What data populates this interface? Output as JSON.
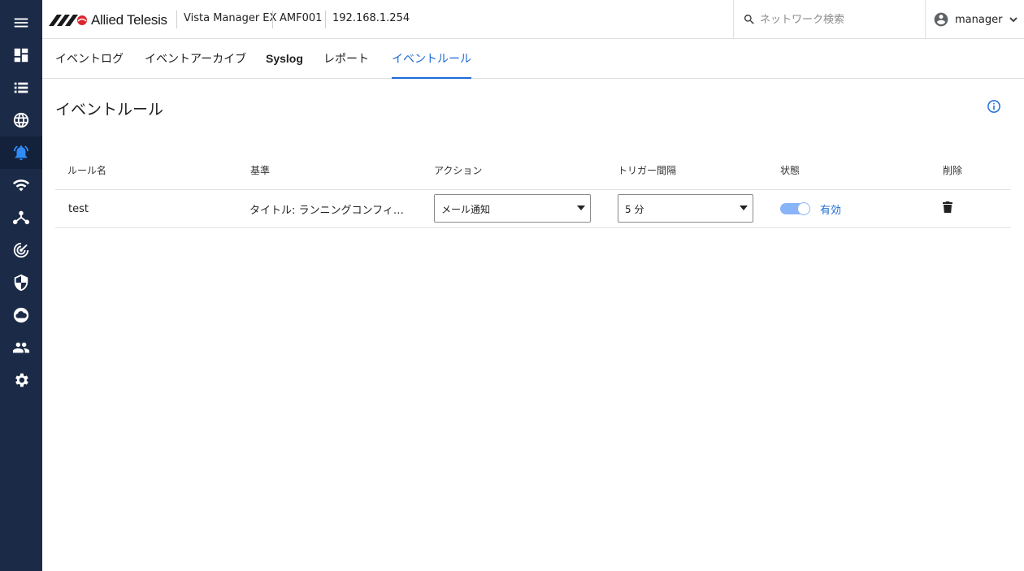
{
  "header": {
    "brand": "Allied Telesis",
    "product": "Vista Manager EX",
    "device": "AMF001",
    "ip": "192.168.1.254",
    "search_placeholder": "ネットワーク検索",
    "user": "manager"
  },
  "sidebar": {
    "items": [
      {
        "name": "menu",
        "icon": "menu-icon"
      },
      {
        "name": "dashboard",
        "icon": "dashboard-icon"
      },
      {
        "name": "list",
        "icon": "list-icon"
      },
      {
        "name": "network",
        "icon": "globe-icon"
      },
      {
        "name": "events",
        "icon": "bell-icon",
        "active": true
      },
      {
        "name": "wireless",
        "icon": "wifi-icon"
      },
      {
        "name": "topology",
        "icon": "topology-icon"
      },
      {
        "name": "monitor",
        "icon": "radar-icon"
      },
      {
        "name": "security",
        "icon": "shield-icon"
      },
      {
        "name": "cloud",
        "icon": "cloud-icon"
      },
      {
        "name": "users",
        "icon": "people-icon"
      },
      {
        "name": "settings",
        "icon": "gear-icon"
      }
    ]
  },
  "tabs": [
    {
      "label": "イベントログ"
    },
    {
      "label": "イベントアーカイブ"
    },
    {
      "label": "Syslog"
    },
    {
      "label": "レポート"
    },
    {
      "label": "イベントルール",
      "active": true
    }
  ],
  "page": {
    "title": "イベントルール"
  },
  "table": {
    "columns": [
      "ルール名",
      "基準",
      "アクション",
      "トリガー間隔",
      "状態",
      "削除"
    ],
    "rows": [
      {
        "name": "test",
        "criteria": "タイトル: ランニングコンフィ…",
        "action": "メール通知",
        "interval": "5 分",
        "enabled": true,
        "status": "有効"
      }
    ]
  },
  "colors": {
    "sidebar_bg": "#1b2a47",
    "accent": "#1e6bd6",
    "active_icon": "#2f8cf6",
    "toggle_track": "#8ab4f8"
  }
}
